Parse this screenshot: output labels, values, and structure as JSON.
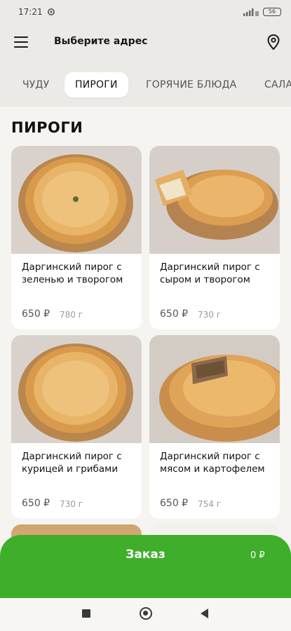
{
  "status_bar": {
    "time": "17:21",
    "battery": "56"
  },
  "header": {
    "address_placeholder": "Выберите адрес"
  },
  "tabs": [
    "ЧУДУ",
    "ПИРОГИ",
    "ГОРЯЧИЕ БЛЮДА",
    "САЛА"
  ],
  "active_tab": "ПИРОГИ",
  "section": {
    "title": "ПИРОГИ"
  },
  "products": [
    {
      "name": "Даргинский пирог с зеленью и творогом",
      "price": "650 ₽",
      "weight": "780 г"
    },
    {
      "name": "Даргинский пирог с сыром и творогом",
      "price": "650 ₽",
      "weight": "730 г"
    },
    {
      "name": "Даргинский пирог с курицей и грибами",
      "price": "650 ₽",
      "weight": "730 г"
    },
    {
      "name": "Даргинский пирог с мясом и картофелем",
      "price": "650 ₽",
      "weight": "754 г"
    }
  ],
  "order": {
    "label": "Заказ",
    "total": "0 ₽"
  },
  "colors": {
    "accent": "#3fae2a",
    "background": "#f5f4f1",
    "header": "#eceae6"
  }
}
